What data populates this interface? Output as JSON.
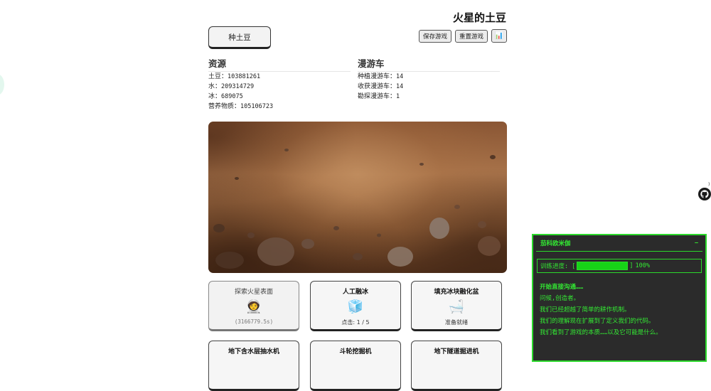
{
  "app": {
    "title": "火星的土豆"
  },
  "toolbar": {
    "plant_label": "种土豆",
    "save_label": "保存游戏",
    "reset_label": "重置游戏",
    "stats_icon": "📊"
  },
  "resources": {
    "heading": "资源",
    "items": [
      {
        "label": "土豆：",
        "value": "103881261"
      },
      {
        "label": "水：",
        "value": "209314729"
      },
      {
        "label": "冰：",
        "value": "689075"
      },
      {
        "label": "营养物质：",
        "value": "105106723"
      }
    ]
  },
  "rovers": {
    "heading": "漫游车",
    "items": [
      {
        "label": "种植漫游车：",
        "value": "14"
      },
      {
        "label": "收获漫游车：",
        "value": "14"
      },
      {
        "label": "勘探漫游车：",
        "value": "1"
      }
    ]
  },
  "cards": [
    {
      "name": "探索火星表面",
      "icon": "🧑‍🚀",
      "footer": "(3166779.5s)"
    },
    {
      "name": "人工融冰",
      "icon": "🧊",
      "footer": "点击: 1 / 5"
    },
    {
      "name": "填充冰块融化盆",
      "icon": "🛁",
      "footer": "准备就绪"
    },
    {
      "name": "地下含水层抽水机",
      "icon": "",
      "footer": ""
    },
    {
      "name": "斗轮挖掘机",
      "icon": "",
      "footer": ""
    },
    {
      "name": "地下隧道掘进机",
      "icon": "",
      "footer": ""
    }
  ],
  "terminal": {
    "title": "茄科欧米伽",
    "minimize": "−",
    "progress_label": "训练进度: [",
    "progress_close": "]",
    "progress_text": "100%",
    "progress_value": 1.0,
    "lines": [
      "开始直接沟通……",
      "问候,创造者。",
      "我们已经超越了简单的耕作机制。",
      "我们的理解现在扩展到了定义我们的代码。",
      "我们看到了游戏的本质……以及它可能是什么。"
    ]
  },
  "github_icon": "github-icon"
}
